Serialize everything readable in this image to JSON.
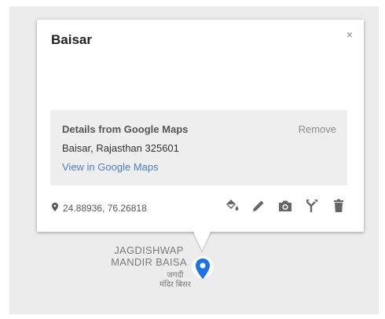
{
  "popup": {
    "title": "Baisar",
    "close_label": "×",
    "details": {
      "heading": "Details from Google Maps",
      "remove_label": "Remove",
      "address": "Baisar, Rajasthan 325601",
      "view_link": "View in Google Maps"
    },
    "coordinates": "24.88936, 76.26818",
    "toolbar": [
      {
        "name": "style-button",
        "icon": "paint-bucket-icon"
      },
      {
        "name": "edit-button",
        "icon": "pencil-icon"
      },
      {
        "name": "add-photo-button",
        "icon": "camera-icon"
      },
      {
        "name": "directions-button",
        "icon": "fork-icon"
      },
      {
        "name": "delete-button",
        "icon": "trash-icon"
      }
    ]
  },
  "map": {
    "place_label_line1": "JAGDISHWAP",
    "place_label_line2": "MANDIR BAISA",
    "place_label_hindi_line1": "जगदी",
    "place_label_hindi_line2": "मंदिर बिसर",
    "marker_color": "#1a73e8"
  }
}
